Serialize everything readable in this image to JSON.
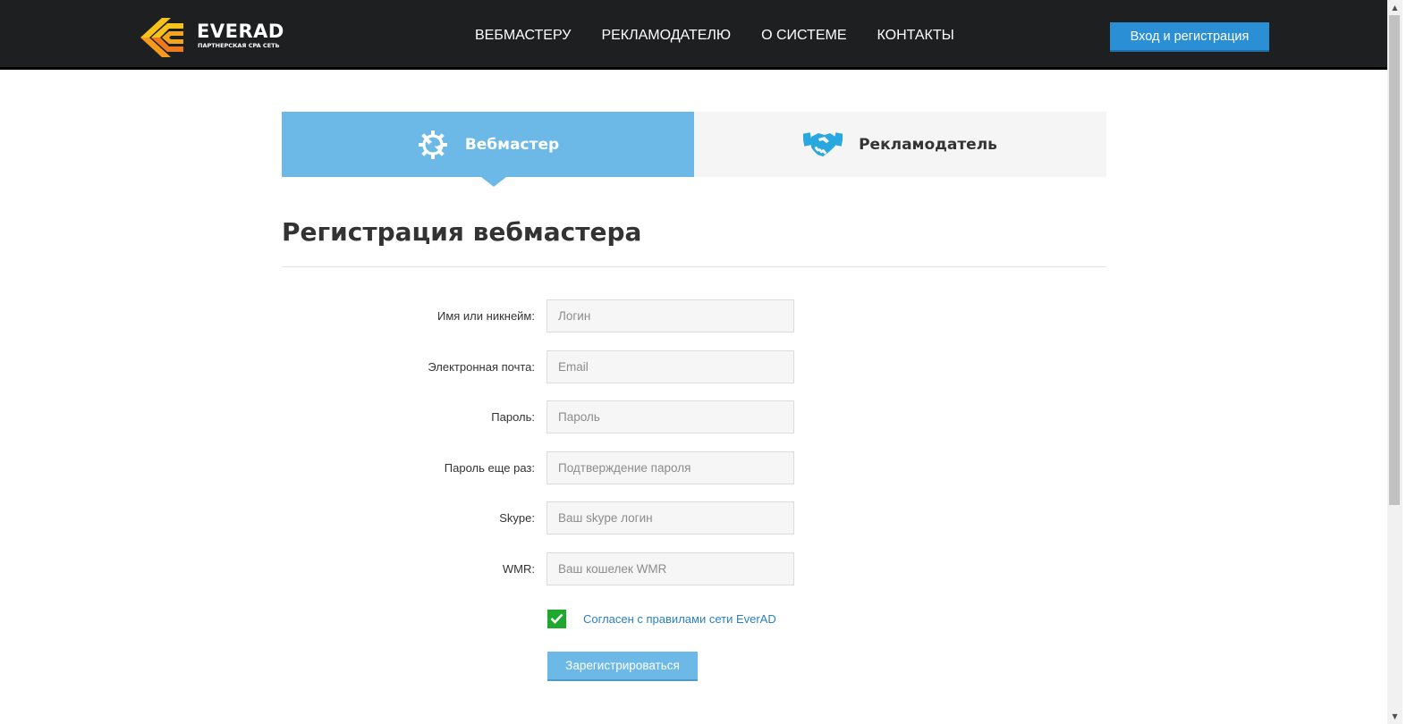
{
  "header": {
    "logo": {
      "word": "EVERAD",
      "subtitle": "ПАРТНЕРСКАЯ CPA СЕТЬ",
      "icon": "everad-logo-mark"
    },
    "nav": [
      {
        "label": "ВЕБМАСТЕРУ"
      },
      {
        "label": "РЕКЛАМОДАТЕЛЮ"
      },
      {
        "label": "О СИСТЕМЕ"
      },
      {
        "label": "КОНТАКТЫ"
      }
    ],
    "login_button": "Вход и регистрация"
  },
  "tabs": [
    {
      "label": "Вебмастер",
      "icon": "gear-wrench-icon",
      "active": true
    },
    {
      "label": "Рекламодатель",
      "icon": "handshake-icon",
      "active": false
    }
  ],
  "form": {
    "title": "Регистрация вебмастера",
    "fields": [
      {
        "label": "Имя или никнейм:",
        "placeholder": "Логин",
        "value": ""
      },
      {
        "label": "Электронная почта:",
        "placeholder": "Email",
        "value": ""
      },
      {
        "label": "Пароль:",
        "placeholder": "Пароль",
        "value": ""
      },
      {
        "label": "Пароль еще раз:",
        "placeholder": "Подтверждение пароля",
        "value": ""
      },
      {
        "label": "Skype:",
        "placeholder": "Ваш skype логин",
        "value": ""
      },
      {
        "label": "WMR:",
        "placeholder": "Ваш кошелек WMR",
        "value": ""
      }
    ],
    "agree": {
      "checked": true,
      "label": "Согласен с правилами сети EverAD"
    },
    "submit": "Зарегистрироваться"
  },
  "colors": {
    "header_bg": "#1e1f21",
    "accent_blue": "#2a8fd4",
    "tab_active": "#6cb9e7",
    "tab_inactive": "#f5f5f5",
    "link": "#2a7fc1",
    "checkbox": "#1ea82d"
  }
}
